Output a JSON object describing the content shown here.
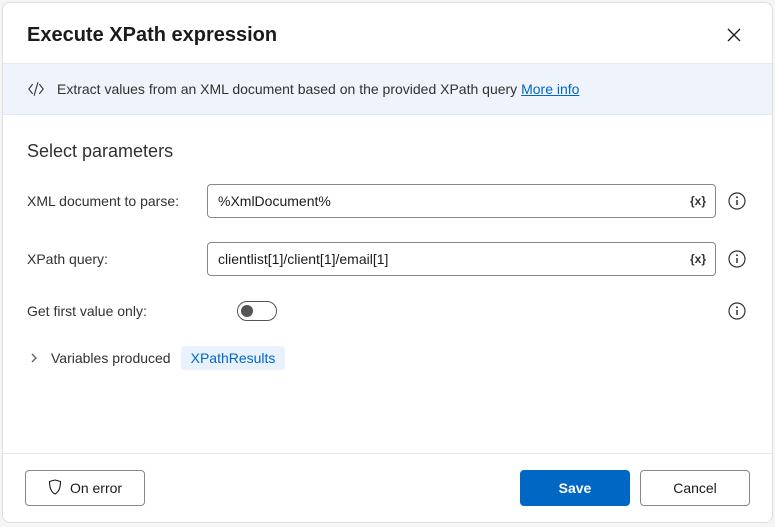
{
  "dialog": {
    "title": "Execute XPath expression"
  },
  "banner": {
    "text": "Extract values from an XML document based on the provided XPath query ",
    "more_info": "More info"
  },
  "section": {
    "title": "Select parameters"
  },
  "fields": {
    "xml_doc": {
      "label": "XML document to parse:",
      "value": "%XmlDocument%"
    },
    "xpath": {
      "label": "XPath query:",
      "value": "clientlist[1]/client[1]/email[1]"
    },
    "first_only": {
      "label": "Get first value only:",
      "value": false
    }
  },
  "variables": {
    "label": "Variables produced",
    "chip": "XPathResults"
  },
  "buttons": {
    "on_error": "On error",
    "save": "Save",
    "cancel": "Cancel",
    "var_token": "{x}"
  }
}
